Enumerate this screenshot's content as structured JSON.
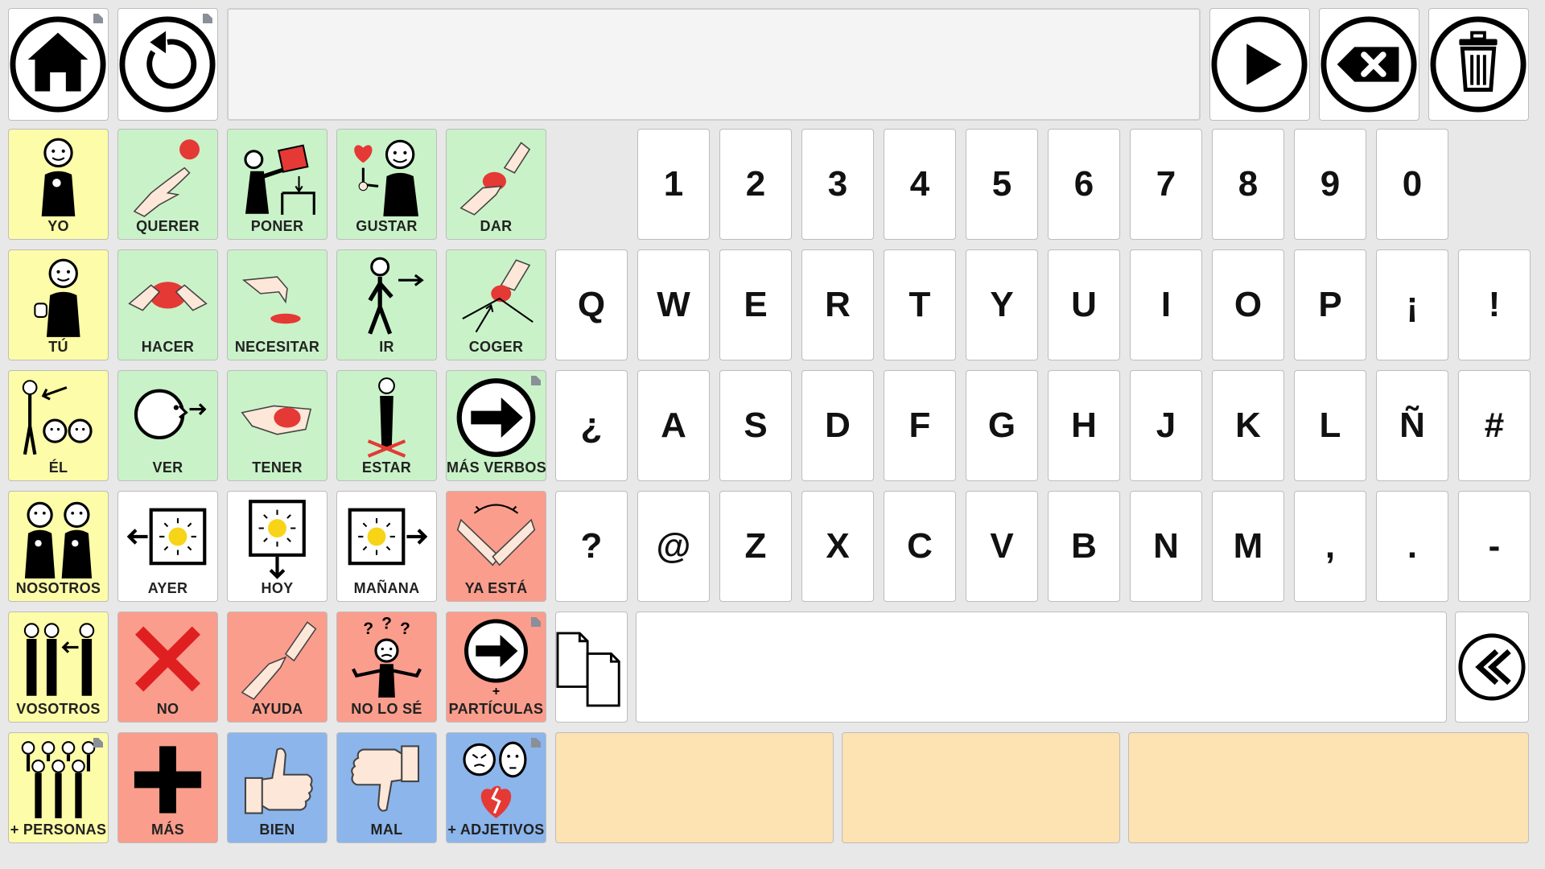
{
  "toolbar": {
    "home_icon": "home-icon",
    "back_icon": "undo-icon",
    "speak_icon": "play-icon",
    "backspace_icon": "backspace-icon",
    "clear_icon": "trash-icon",
    "message": ""
  },
  "words": {
    "yo": "YO",
    "querer": "QUERER",
    "poner": "PONER",
    "gustar": "GUSTAR",
    "dar": "DAR",
    "tu": "TÚ",
    "hacer": "HACER",
    "necesitar": "NECESITAR",
    "ir": "IR",
    "coger": "COGER",
    "el": "ÉL",
    "ver": "VER",
    "tener": "TENER",
    "estar": "ESTAR",
    "mas_verbos": "MÁS VERBOS",
    "nosotros": "NOSOTROS",
    "ayer": "AYER",
    "hoy": "HOY",
    "manana": "MAÑANA",
    "ya_esta": "YA ESTÁ",
    "vosotros": "VOSOTROS",
    "no": "NO",
    "ayuda": "AYUDA",
    "no_lo_se": "NO LO SÉ",
    "particulas": "PARTÍCULAS",
    "particulas_plus": "+",
    "personas": "+ PERSONAS",
    "mas": "MÁS",
    "bien": "BIEN",
    "mal": "MAL",
    "adjetivos": "+ ADJETIVOS"
  },
  "keyboard": {
    "row0": [
      "1",
      "2",
      "3",
      "4",
      "5",
      "6",
      "7",
      "8",
      "9",
      "0"
    ],
    "row1": [
      "Q",
      "W",
      "E",
      "R",
      "T",
      "Y",
      "U",
      "I",
      "O",
      "P",
      "¡",
      "!"
    ],
    "row2": [
      "¿",
      "A",
      "S",
      "D",
      "F",
      "G",
      "H",
      "J",
      "K",
      "L",
      "Ñ",
      "#"
    ],
    "row3": [
      "?",
      "@",
      "Z",
      "X",
      "C",
      "V",
      "B",
      "N",
      "M",
      ",",
      ".",
      "-"
    ]
  },
  "text_area": "",
  "copy_icon": "copy-icon",
  "collapse_icon": "double-chevron-left-icon",
  "colors": {
    "people": "#fdfca8",
    "verbs": "#c9f2c8",
    "social": "#fa9d8c",
    "adjectives": "#8cb5ec",
    "empty_slots": "#fde2b2",
    "background": "#e8e8e8"
  }
}
